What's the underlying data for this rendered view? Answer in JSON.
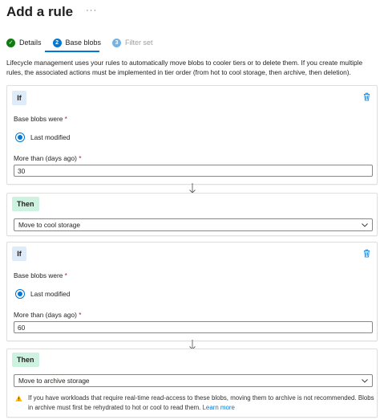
{
  "header": {
    "title": "Add a rule",
    "more_label": "···"
  },
  "steps": [
    {
      "number": "✓",
      "label": "Details",
      "state": "done"
    },
    {
      "number": "2",
      "label": "Base blobs",
      "state": "current"
    },
    {
      "number": "3",
      "label": "Filter set",
      "state": "disabled"
    }
  ],
  "description": "Lifecycle management uses your rules to automatically move blobs to cooler tiers or to delete them. If you create multiple rules, the associated actions must be implemented in tier order (from hot to cool storage, then archive, then deletion).",
  "conditions": [
    {
      "if_tag": "If",
      "base_blobs_label": "Base blobs were",
      "required_marker": "*",
      "radio_label": "Last modified",
      "days_label": "More than (days ago)",
      "days_value": "30",
      "then_tag": "Then",
      "action_value": "Move to cool storage"
    },
    {
      "if_tag": "If",
      "base_blobs_label": "Base blobs were",
      "required_marker": "*",
      "radio_label": "Last modified",
      "days_label": "More than (days ago)",
      "days_value": "60",
      "then_tag": "Then",
      "action_value": "Move to archive storage"
    }
  ],
  "warning": {
    "text": "If you have workloads that require real-time read-access to these blobs, moving them to archive is not recommended. Blobs in archive must first be rehydrated to hot or cool to read them.",
    "link": "Learn more"
  },
  "colors": {
    "accent": "#0078d4",
    "success": "#107c10",
    "if_bg": "#deecf9",
    "then_bg": "#cdf2e0",
    "warning": "#ffb900"
  },
  "icons": {
    "delete": "trash-icon",
    "dropdown": "chevron-down-icon",
    "warning": "warning-icon",
    "flow": "arrow-down-icon"
  }
}
